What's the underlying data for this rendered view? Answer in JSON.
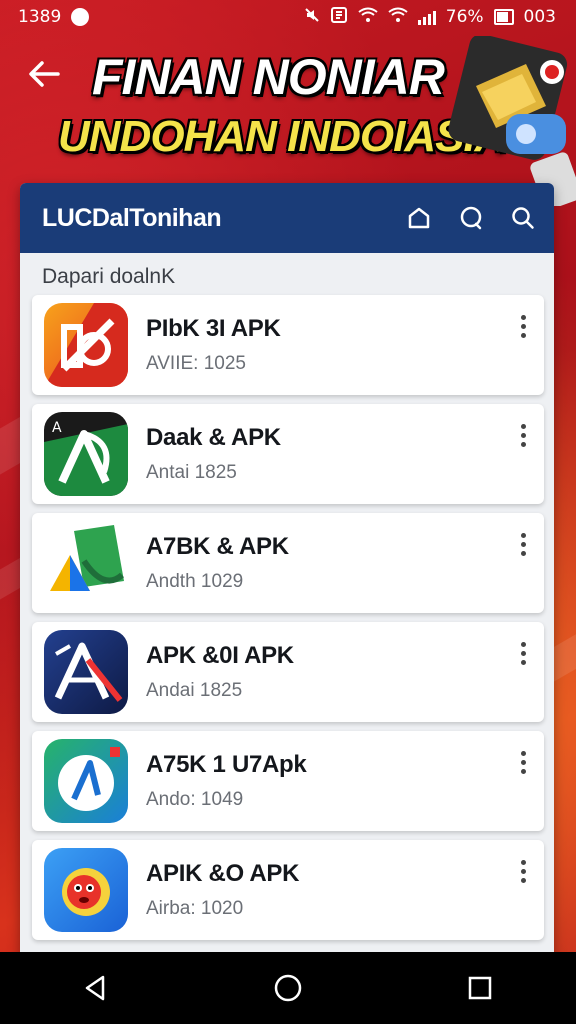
{
  "status_bar": {
    "time": "1389",
    "battery": "76%",
    "extra": "003"
  },
  "header": {
    "title_line1": "FINAN NONIAR",
    "title_line2": "UNDOHAN INDOIASIA"
  },
  "appbar": {
    "brand": "LUCDalTonihan"
  },
  "section": {
    "label": "Dapari doalnK"
  },
  "apps": [
    {
      "name": "PIbK 3I APK",
      "sub": "AVIIE: 1025",
      "color": "#f05a28"
    },
    {
      "name": "Daak & APK",
      "sub": "Antai 1825",
      "color": "#1f7a3b"
    },
    {
      "name": "A7BK & APK",
      "sub": "Andth 1029",
      "color": "#2e9d4a"
    },
    {
      "name": "APK &0I APK",
      "sub": "Andai 1825",
      "color": "#1c2f6e"
    },
    {
      "name": "A75K 1 U7Apk",
      "sub": "Ando: 1049",
      "color": "#1ea86b"
    },
    {
      "name": "APIK &O APK",
      "sub": "Airba: 1020",
      "color": "#2b8ee8"
    }
  ]
}
